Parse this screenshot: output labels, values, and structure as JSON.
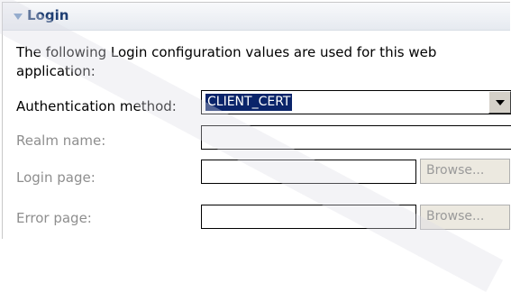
{
  "section": {
    "title": "Login",
    "description": "The following Login configuration values are used for this web application:"
  },
  "fields": {
    "auth_method": {
      "label": "Authentication method:",
      "value": "CLIENT_CERT"
    },
    "realm_name": {
      "label": "Realm name:",
      "value": ""
    },
    "login_page": {
      "label": "Login page:",
      "value": "",
      "browse_label": "Browse..."
    },
    "error_page": {
      "label": "Error page:",
      "value": "",
      "browse_label": "Browse..."
    }
  },
  "icons": {
    "collapse": "triangle-down-icon",
    "combo": "chevron-down-icon"
  }
}
